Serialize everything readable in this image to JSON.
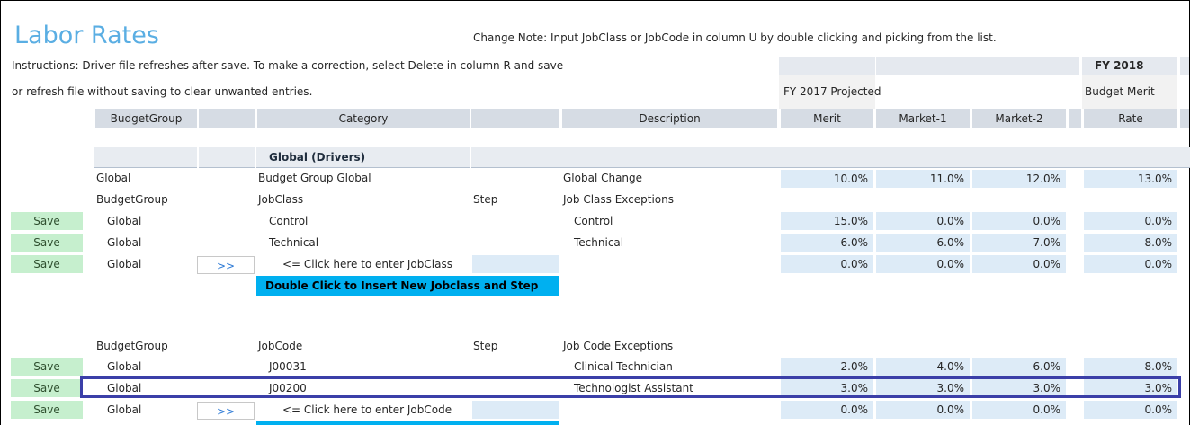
{
  "header": {
    "title": "Labor Rates",
    "change_note": "Change Note: Input JobClass or JobCode in column U by double clicking and picking from the list.",
    "instructions_line1": "Instructions:  Driver file refreshes after save.  To make a correction, select Delete in column R and save",
    "instructions_line2": "or refresh file without saving to clear unwanted entries.",
    "fy_2018": "FY 2018",
    "fy_2017_projected": "FY 2017 Projected",
    "budget_merit": "Budget Merit"
  },
  "columns": {
    "budget_group": "BudgetGroup",
    "category": "Category",
    "description": "Description",
    "merit": "Merit",
    "market1": "Market-1",
    "market2": "Market-2",
    "rate": "Rate"
  },
  "section": {
    "title": "Global (Drivers)"
  },
  "global_row": {
    "budget_group": "Global",
    "category": "Budget Group Global",
    "description": "Global Change",
    "merit": "10.0%",
    "market1": "11.0%",
    "market2": "12.0%",
    "rate": "13.0%"
  },
  "jobclass_header": {
    "budget_group": "BudgetGroup",
    "category": "JobClass",
    "step": "Step",
    "description": "Job Class Exceptions"
  },
  "jobclass_rows": [
    {
      "save": "Save",
      "budget_group": "Global",
      "category": "Control",
      "description": "Control",
      "merit": "15.0%",
      "market1": "0.0%",
      "market2": "0.0%",
      "rate": "0.0%"
    },
    {
      "save": "Save",
      "budget_group": "Global",
      "category": "Technical",
      "description": "Technical",
      "merit": "6.0%",
      "market1": "6.0%",
      "market2": "7.0%",
      "rate": "8.0%"
    },
    {
      "save": "Save",
      "budget_group": "Global",
      "arrow": ">>",
      "category": "<= Click here to enter JobClass",
      "description": "",
      "merit": "0.0%",
      "market1": "0.0%",
      "market2": "0.0%",
      "rate": "0.0%"
    }
  ],
  "insert_button": "Double Click to Insert New Jobclass and Step",
  "jobcode_header": {
    "budget_group": "BudgetGroup",
    "category": "JobCode",
    "step": "Step",
    "description": "Job Code Exceptions"
  },
  "jobcode_rows": [
    {
      "save": "Save",
      "budget_group": "Global",
      "category": "J00031",
      "description": "Clinical Technician",
      "merit": "2.0%",
      "market1": "4.0%",
      "market2": "6.0%",
      "rate": "8.0%"
    },
    {
      "save": "Save",
      "budget_group": "Global",
      "category": "J00200",
      "description": "Technologist Assistant",
      "merit": "3.0%",
      "market1": "3.0%",
      "market2": "3.0%",
      "rate": "3.0%"
    },
    {
      "save": "Save",
      "budget_group": "Global",
      "arrow": ">>",
      "category": "<= Click here to enter JobCode",
      "description": "",
      "merit": "0.0%",
      "market1": "0.0%",
      "market2": "0.0%",
      "rate": "0.0%"
    }
  ],
  "colors": {
    "title": "#5aaee3",
    "save_fill": "#c6efce",
    "value_fill": "#ddebf7",
    "insert_button": "#00b0f0",
    "highlight_border": "#3b3fa8"
  }
}
